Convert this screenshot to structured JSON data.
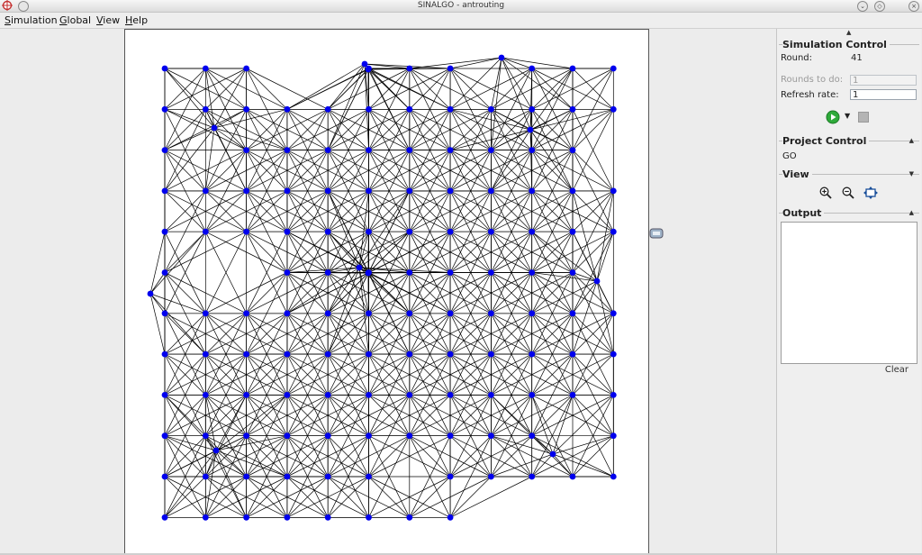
{
  "window": {
    "title": "SINALGO - antrouting",
    "controls": [
      "chevron-down-icon",
      "restore-icon",
      "close-icon"
    ]
  },
  "menu": [
    {
      "label": "Simulation"
    },
    {
      "label": "Global"
    },
    {
      "label": "View"
    },
    {
      "label": "Help"
    }
  ],
  "simulation_control": {
    "title": "Simulation Control",
    "round_label": "Round:",
    "round_value": "41",
    "rounds_to_do_label": "Rounds to do:",
    "rounds_to_do_value": "1",
    "refresh_rate_label": "Refresh rate:",
    "refresh_rate_value": "1",
    "run_icon": "play-icon",
    "stop_icon": "stop-icon"
  },
  "project_control": {
    "title": "Project Control",
    "button_label": "GO"
  },
  "view_section": {
    "title": "View",
    "icons": [
      "zoom-in-icon",
      "zoom-out-icon",
      "zoom-to-fit-icon"
    ]
  },
  "output_section": {
    "title": "Output",
    "clear_label": "Clear"
  },
  "graph": {
    "node_color": "#0000ee",
    "edge_color": "#000000",
    "grid_rows": 12,
    "grid_cols": 12,
    "last_row_node_count": 8
  }
}
